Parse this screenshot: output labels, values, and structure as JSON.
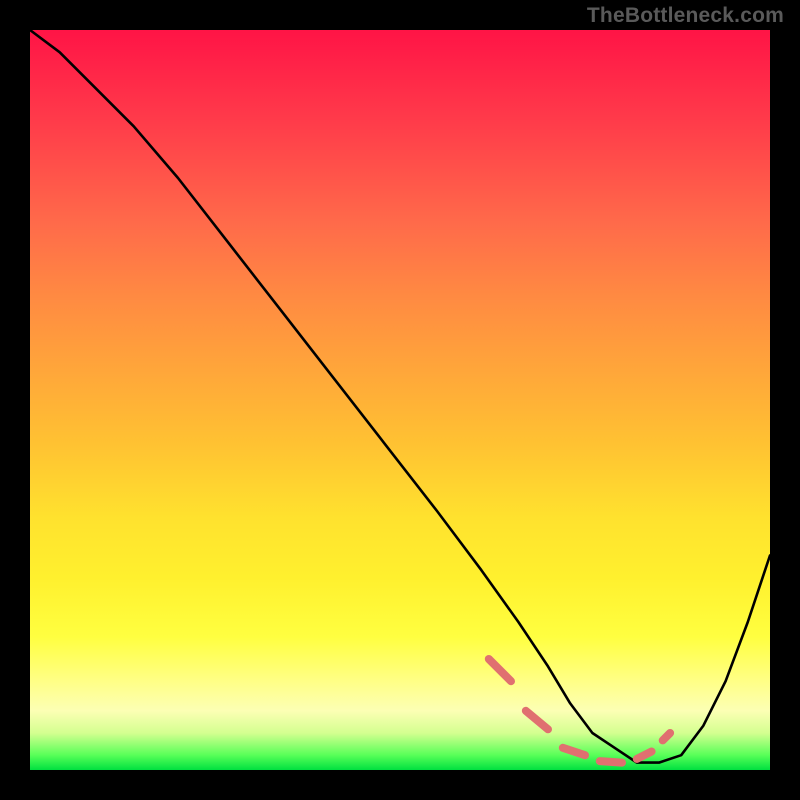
{
  "watermark": "TheBottleneck.com",
  "chart_data": {
    "type": "line",
    "title": "",
    "xlabel": "",
    "ylabel": "",
    "xlim": [
      0,
      100
    ],
    "ylim": [
      0,
      100
    ],
    "grid": false,
    "series": [
      {
        "name": "bottleneck-curve",
        "x": [
          0,
          4,
          9,
          14,
          20,
          27,
          34,
          41,
          48,
          55,
          61,
          66,
          70,
          73,
          76,
          79,
          82,
          85,
          88,
          91,
          94,
          97,
          100
        ],
        "y": [
          100,
          97,
          92,
          87,
          80,
          71,
          62,
          53,
          44,
          35,
          27,
          20,
          14,
          9,
          5,
          3,
          1,
          1,
          2,
          6,
          12,
          20,
          29
        ]
      }
    ],
    "annotations": [
      {
        "name": "sweet-spot-dashes",
        "style": "pink-dash",
        "segments": [
          {
            "x": [
              62,
              65
            ],
            "y": [
              15,
              12
            ]
          },
          {
            "x": [
              67,
              70
            ],
            "y": [
              8,
              5.5
            ]
          },
          {
            "x": [
              72,
              75
            ],
            "y": [
              3,
              2
            ]
          },
          {
            "x": [
              77,
              80
            ],
            "y": [
              1.2,
              1
            ]
          },
          {
            "x": [
              82,
              84
            ],
            "y": [
              1.5,
              2.5
            ]
          },
          {
            "x": [
              85.5,
              86.5
            ],
            "y": [
              4,
              5
            ]
          }
        ]
      }
    ]
  }
}
